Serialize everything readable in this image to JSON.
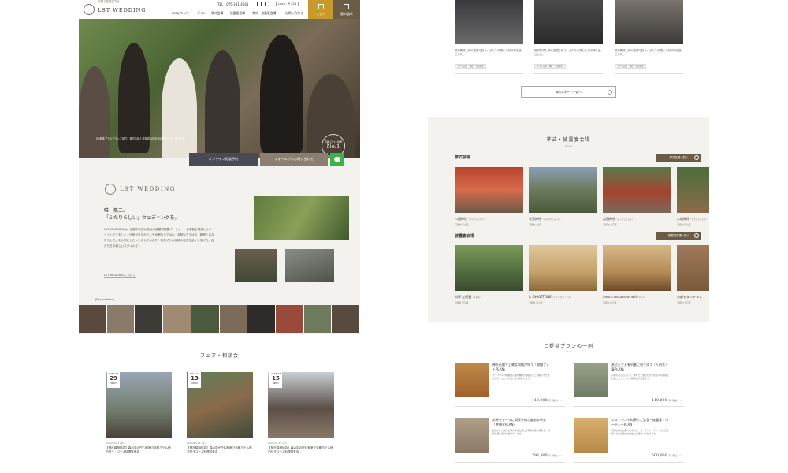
{
  "left": {
    "header": {
      "logo_sub": "京都で結婚式なら",
      "logo": "LST WEDDING",
      "tel": "TEL : 075-331-4661",
      "lang": "Lang : JP / EN",
      "nav": [
        "LSTについて",
        "プラン",
        "挙式会場",
        "披露宴会場",
        "挙式・披露宴会場",
        "お問い合わせ"
      ],
      "btn_fair": "フェア",
      "btn_request": "資料請求"
    },
    "hero": {
      "caption": "【京都婚プラスプランご紹介】挙式会場と披露宴会場を組み合わせた、最大人数",
      "badge_top": "京都 口コミ評価",
      "badge_main": "No.1"
    },
    "cta": {
      "online": "オンライン相談予約",
      "form": "フォームからお問い合わせ"
    },
    "about": {
      "brand": "LST WEDDING",
      "catch1": "唯一無二、",
      "catch2": "「ふたりらしい」ウェディングを。",
      "body": "LST WEDDINGは、京都市伏見に拠点の結婚式披露パーティー・食事会を提案しサポートしてきました。伝統があるからこそ京都ならではの、本物ならではの「新郎とあなたらしさ」を大切にしたいと考えています。昔ながらの京都の良さを活かしながら、自分たちの新しいスタイルで…",
      "link": "LST WEDDINGについて"
    },
    "insta": "@lst_wedding",
    "fair": {
      "title": "フェア・相談会",
      "cards": [
        {
          "month": "2023.03",
          "day": "29",
          "weekday": "WED",
          "date": "2023/03/29 (水)",
          "title": "【神社婚相談会】森の中の佇む和室で京都ホテル宿泊付き・コース料理試食会",
          "color": "#9aa6b4"
        },
        {
          "month": "2023.03",
          "day": "13",
          "weekday": "MON",
          "date": "2023/03/13 (月)",
          "title": "【神社婚相談会】森の中が佇む和室で京都ホテル宿泊付きコース料理試食会",
          "color": "#5e7f5a"
        },
        {
          "month": "2023.03",
          "day": "15",
          "weekday": "WED",
          "date": "2023/03/15 (水)",
          "title": "【神社婚相談会】森の中の佇む和室で京都ホテル宿泊付きコース料理試食会",
          "color": "#5b4e45"
        }
      ]
    }
  },
  "right": {
    "reports": [
      {
        "text": "和式挙式と和の空間で祝う。ふたりの想いと京の時を過ごした。",
        "tag": "プラン実例　神社・寺院挙式"
      },
      {
        "text": "和式挙式と和の空間で祝う。ふたりの想いと京の時を過ごした。",
        "tag": "プラン実例　神社・寺院挙式"
      },
      {
        "text": "和式挙式と和の空間で祝う。ふたりの想いと京の時を過ごした。",
        "tag": "プラン実例　神社・寺院挙式"
      }
    ],
    "reports_btn": "挙式レポート一覧へ",
    "venue": {
      "title": "挙式・披露宴会場",
      "sub": "Venue",
      "ceremony_h": "挙式会場",
      "ceremony_btn": "挙式会場一覧へ",
      "ceremony": [
        {
          "name": "八坂神社",
          "kana": "（やさかじんじゃ）",
          "loc": "京都市 東山区",
          "color": "#b8442e"
        },
        {
          "name": "今宮神社",
          "kana": "（いまみやじんじゃ）",
          "loc": "京都市 北区",
          "color": "#6b7a5a"
        },
        {
          "name": "吉田神社",
          "kana": "（よしだじんじゃ）",
          "loc": "京都市 左京区",
          "color": "#a5442f"
        },
        {
          "name": "八坂神社",
          "kana": "（やさかじんじゃ）",
          "loc": "京都市 東山区",
          "color": "#4d6e3d"
        }
      ],
      "reception_h": "披露宴会場",
      "reception_btn": "披露宴会場一覧へ",
      "reception": [
        {
          "name": "料亭 左阿彌",
          "kana": "（さあみ）",
          "loc": "京都市 東山区",
          "color": "#4f6b3c"
        },
        {
          "name": "IL GHIOTTONE",
          "kana": "（イル ギオットーネ）",
          "loc": "京都市 東山区",
          "color": "#c4a06a"
        },
        {
          "name": "french restaurant will",
          "kana": "（ウィル）",
          "loc": "京都市 中京区",
          "color": "#b58956"
        },
        {
          "name": "京都モダンテラス",
          "kana": "",
          "loc": "京都市 左京区",
          "color": "#7a5a3d"
        }
      ]
    },
    "plans": {
      "title": "ご提供プランの一例",
      "sub": "Plan",
      "items": [
        {
          "name": "神社仏閣で上質な和婚が叶う「和婚フォトPLAN」",
          "desc": "ブライダルの和婚は京都の神社の雰囲気をご堪能いただきながら、お二人の想いを大切にします。",
          "price": "110,000",
          "unit": "円（税込）～",
          "color": "#a0612d"
        },
        {
          "name": "あぶたり＆参列者に寄り添う「人前式＋宴PLAN」",
          "desc": "京都にあるおぶそう、あなたとあなたの大切な人の時間をお過ごしいただける結婚式の会場です。",
          "price": "110,000",
          "unit": "円（税込）～",
          "color": "#6f7c66"
        },
        {
          "name": "お茶をテーマに両家を結ぶ趣ある挙式「茶婚式PLAN」",
          "desc": "和の心を大切にお茶の文化を通して両家の絆を深める、特別な日に結ぶ挙式プランです。",
          "price": "293,800",
          "unit": "円（税込）～",
          "color": "#8a7a66"
        },
        {
          "name": "レストランや料亭でご会食・披露宴・パーティーPLAN",
          "desc": "京都の神社仏閣での挙式と、ガーデンパーティーのある会場でのお食事会を自由にお選びいただけます。",
          "price": "500,000",
          "unit": "円（税込）～",
          "color": "#b78a48"
        }
      ]
    }
  }
}
